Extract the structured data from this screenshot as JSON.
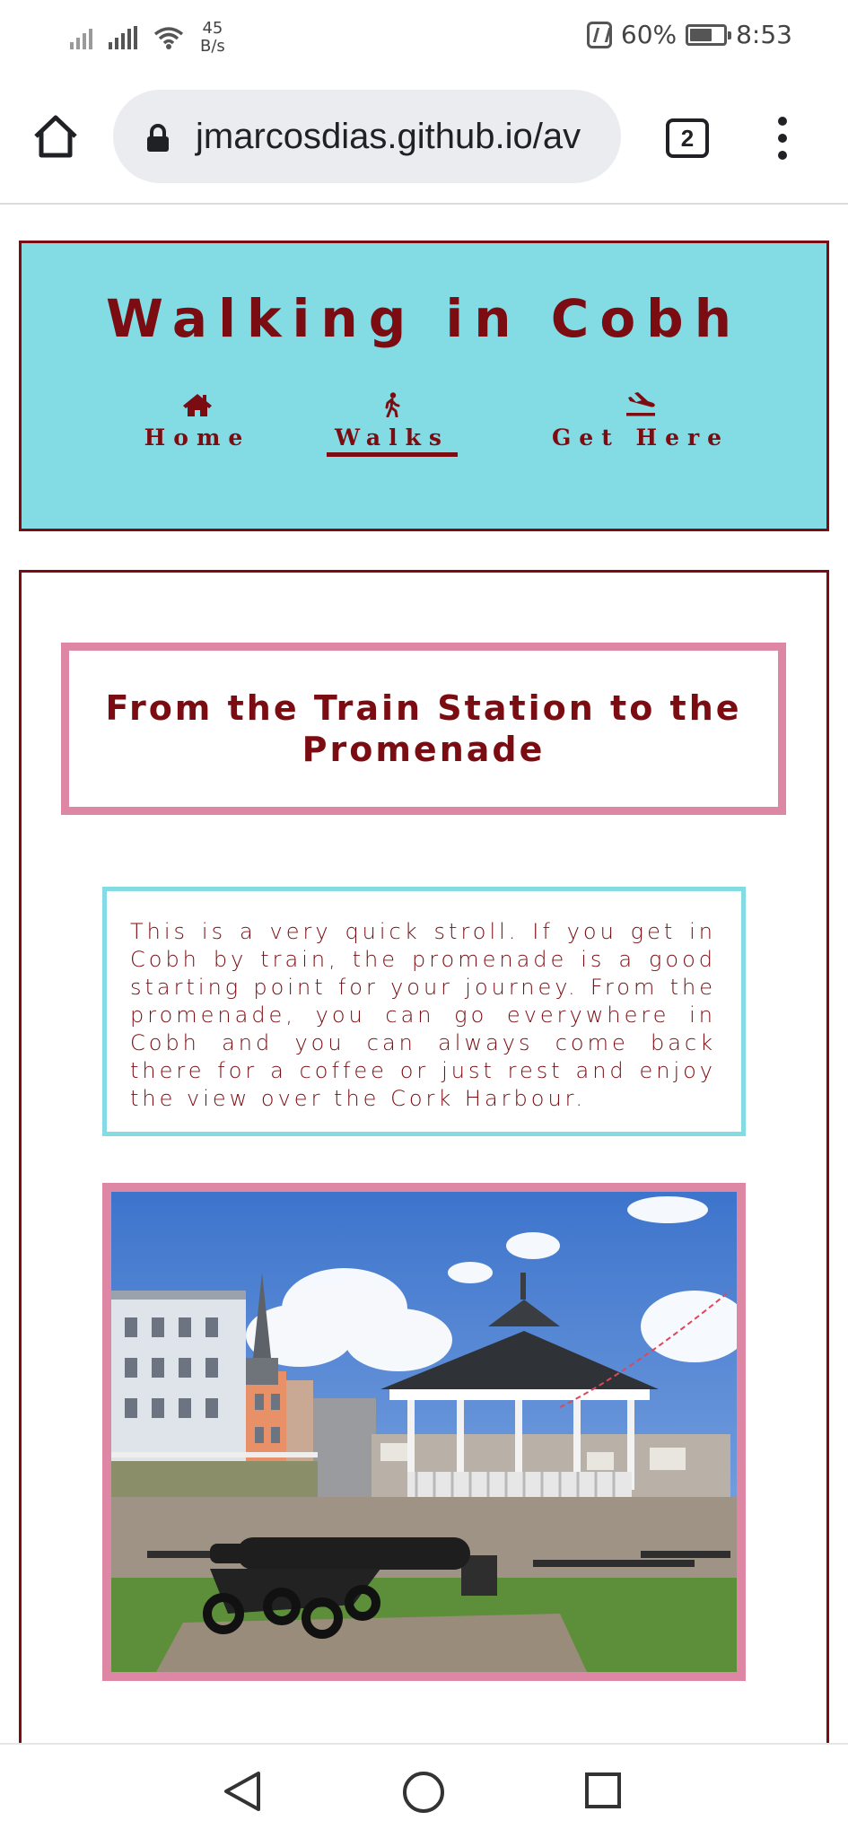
{
  "status_bar": {
    "net_speed_value": "45",
    "net_speed_unit": "B/s",
    "battery": "60%",
    "time": "8:53"
  },
  "browser": {
    "url": "jmarcosdias.github.io/av",
    "tab_count": "2"
  },
  "site": {
    "title": "Walking in Cobh",
    "nav": [
      {
        "label": "Home",
        "icon": "home-icon",
        "active": false
      },
      {
        "label": "Walks",
        "icon": "walking-person-icon",
        "active": true
      },
      {
        "label": "Get Here",
        "icon": "plane-arrival-icon",
        "active": false
      }
    ]
  },
  "walk": {
    "title": "From the Train Station to the Promenade",
    "description": "This is a very quick stroll. If you get in Cobh by train, the promenade is a good starting point for your journey. From the promenade, you can go everywhere in Cobh and you can always come back there for a coffee or just rest and enjoy the view over the Cork Harbour."
  },
  "colors": {
    "maroon": "#7b0d12",
    "header_cyan": "#83dbe4",
    "pink_border": "#dd87a5"
  }
}
